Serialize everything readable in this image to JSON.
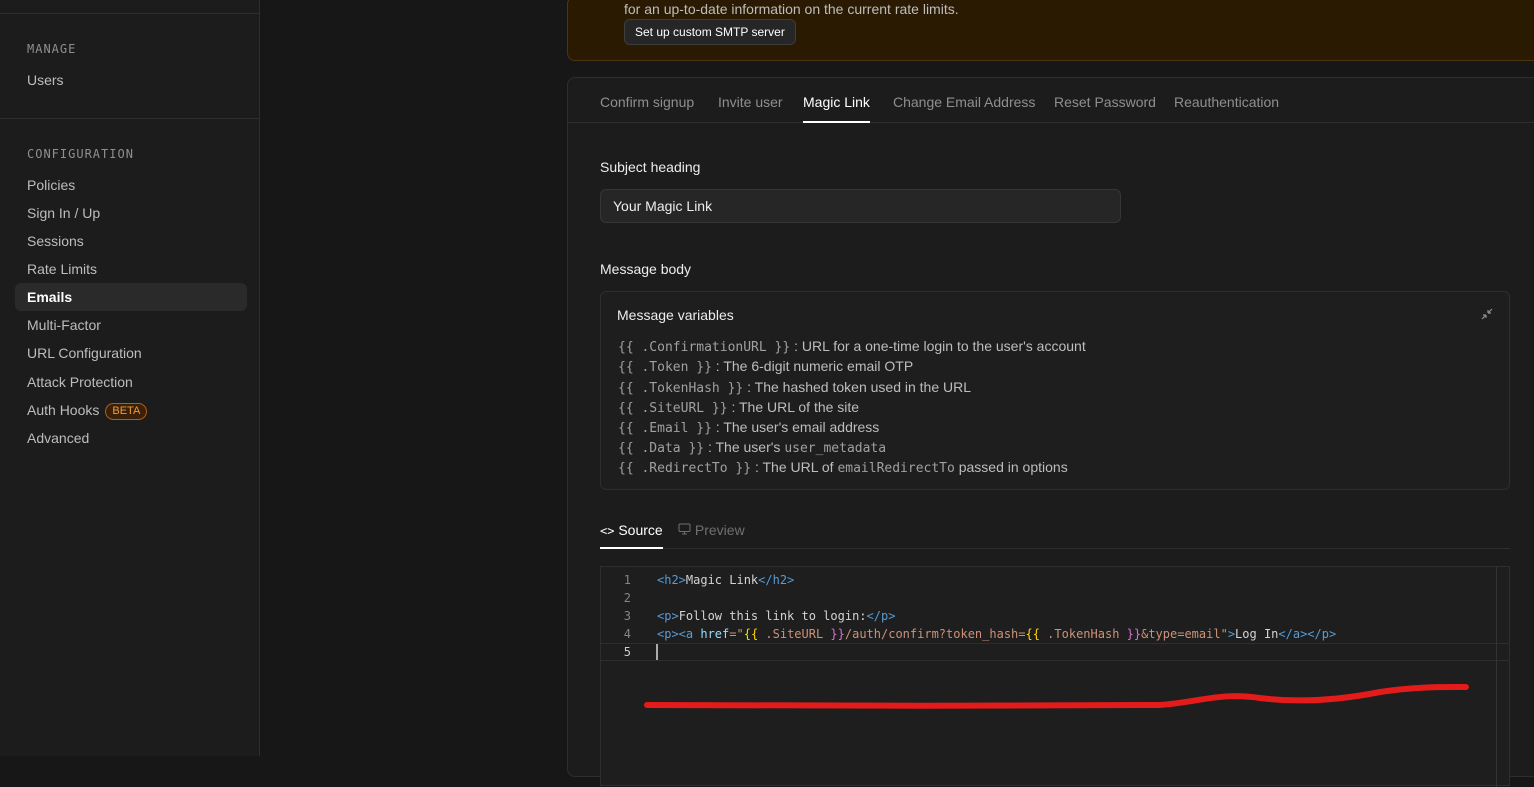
{
  "sidebar": {
    "manage_label": "MANAGE",
    "manage_items": [
      {
        "label": "Users"
      }
    ],
    "config_label": "CONFIGURATION",
    "config_items": [
      {
        "label": "Policies"
      },
      {
        "label": "Sign In / Up"
      },
      {
        "label": "Sessions"
      },
      {
        "label": "Rate Limits"
      },
      {
        "label": "Emails",
        "active": true
      },
      {
        "label": "Multi-Factor"
      },
      {
        "label": "URL Configuration"
      },
      {
        "label": "Attack Protection"
      },
      {
        "label": "Auth Hooks",
        "badge": "BETA"
      },
      {
        "label": "Advanced"
      }
    ]
  },
  "warning": {
    "text": "for an up-to-date information on the current rate limits.",
    "button": "Set up custom SMTP server"
  },
  "tabs": [
    "Confirm signup",
    "Invite user",
    "Magic Link",
    "Change Email Address",
    "Reset Password",
    "Reauthentication"
  ],
  "active_tab": "Magic Link",
  "form": {
    "subject_label": "Subject heading",
    "subject_value": "Your Magic Link",
    "body_label": "Message body",
    "vars_title": "Message variables",
    "vars": [
      {
        "code": "{{ .ConfirmationURL }}",
        "desc": " : URL for a one-time login to the user's account"
      },
      {
        "code": "{{ .Token }}",
        "desc": " : The 6-digit numeric email OTP"
      },
      {
        "code": "{{ .TokenHash }}",
        "desc": " : The hashed token used in the URL"
      },
      {
        "code": "{{ .SiteURL }}",
        "desc": " : The URL of the site"
      },
      {
        "code": "{{ .Email }}",
        "desc": " : The user's email address"
      },
      {
        "code": "{{ .Data }}",
        "desc": " : The user's ",
        "code2": "user_metadata"
      },
      {
        "code": "{{ .RedirectTo }}",
        "desc": " : The URL of ",
        "code2": "emailRedirectTo",
        "desc2": " passed in options"
      }
    ]
  },
  "source_tabs": {
    "source": "Source",
    "preview": "Preview"
  },
  "editor": {
    "line_numbers": [
      "1",
      "2",
      "3",
      "4",
      "5"
    ],
    "l1": {
      "o": "<h2>",
      "t": "Magic Link",
      "c": "</h2>"
    },
    "l3": {
      "o": "<p>",
      "t": "Follow this link to login:",
      "c": "</p>"
    },
    "l4": {
      "p1": "<p><a ",
      "attr": "href",
      "eq": "=\"",
      "b1": "{{",
      "v1": " .SiteURL ",
      "b2": "}}",
      "mid": "/auth/confirm?token_hash=",
      "b3": "{{",
      "v2": " .TokenHash ",
      "b4": "}}",
      "end": "&type=email\"",
      "gt": ">",
      "txt": "Log In",
      "close": "</a></p>"
    }
  },
  "annotation_color": "#e31b1b"
}
